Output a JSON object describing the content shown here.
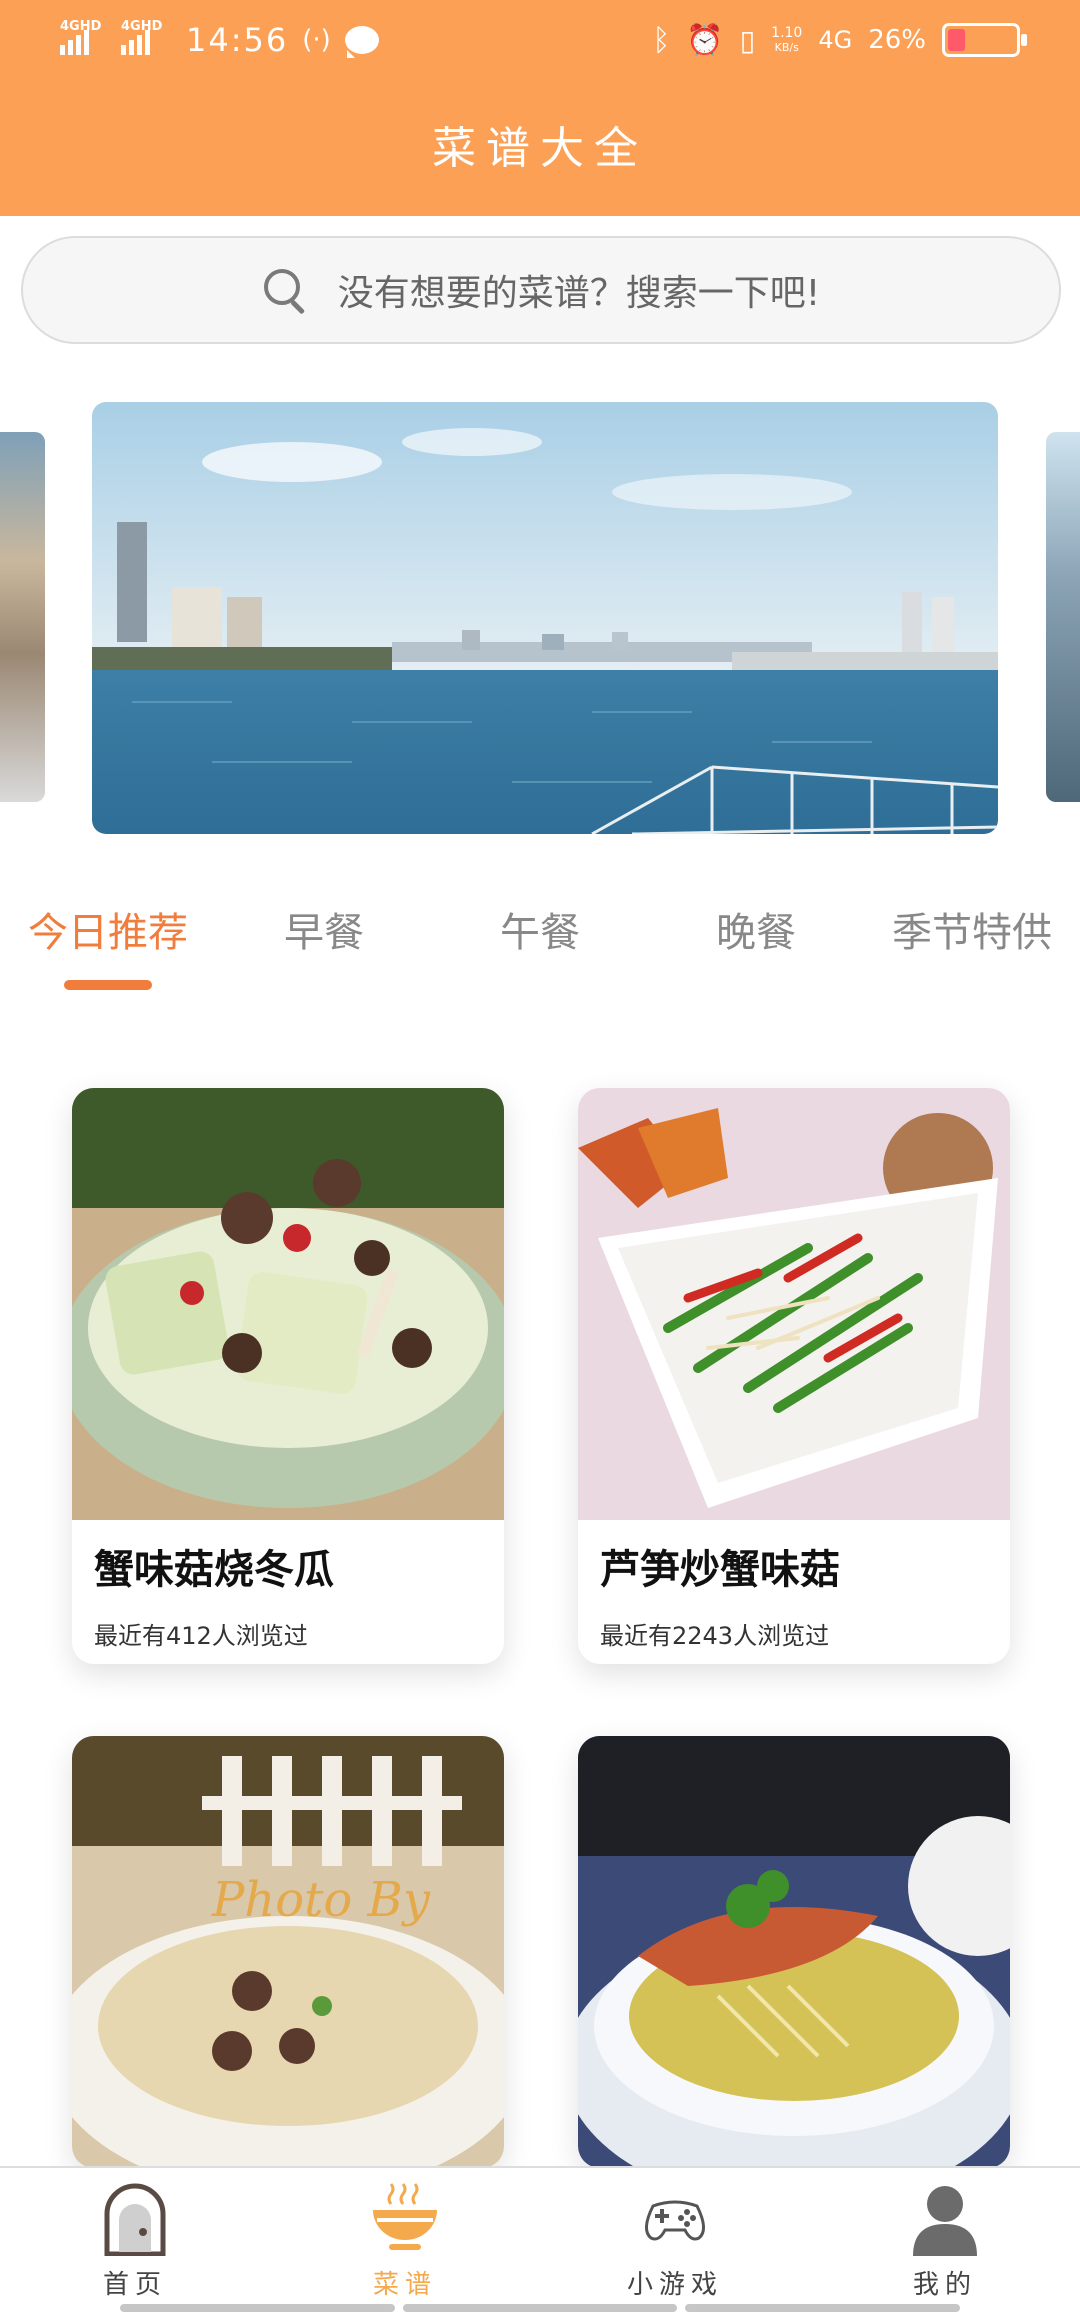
{
  "status_bar": {
    "signal_1_label": "4GHD",
    "signal_2_label": "4GHD",
    "time": "14:56",
    "net_speed_value": "1.10",
    "net_speed_unit": "KB/s",
    "network_type": "4G",
    "battery_percent_text": "26%",
    "battery_level": 0.26,
    "icons": [
      "signal-icon",
      "signal-icon",
      "nfc-icon",
      "chat-icon",
      "bluetooth-icon",
      "alarm-icon",
      "vibrate-icon",
      "battery-icon"
    ]
  },
  "header": {
    "title": "菜谱大全",
    "background_color": "#FCA055"
  },
  "search": {
    "placeholder": "没有想要的菜谱？搜索一下吧!",
    "icon": "search-icon"
  },
  "tabs": {
    "items": [
      {
        "label": "今日推荐",
        "active": true
      },
      {
        "label": "早餐",
        "active": false
      },
      {
        "label": "午餐",
        "active": false
      },
      {
        "label": "晚餐",
        "active": false
      },
      {
        "label": "季节特供",
        "active": false
      }
    ],
    "active_color": "#F07D3C"
  },
  "recipes": [
    {
      "title": "蟹味菇烧冬瓜",
      "views": "最近有412人浏览过"
    },
    {
      "title": "芦笋炒蟹味菇",
      "views": "最近有2243人浏览过"
    },
    {
      "title": "",
      "views": ""
    },
    {
      "title": "",
      "views": ""
    }
  ],
  "bottom_nav": {
    "items": [
      {
        "label": "首页",
        "icon": "home-door-icon",
        "active": false
      },
      {
        "label": "菜谱",
        "icon": "bowl-icon",
        "active": true
      },
      {
        "label": "小游戏",
        "icon": "gamepad-icon",
        "active": false
      },
      {
        "label": "我的",
        "icon": "user-icon",
        "active": false
      }
    ],
    "active_color": "#F5A94D"
  }
}
